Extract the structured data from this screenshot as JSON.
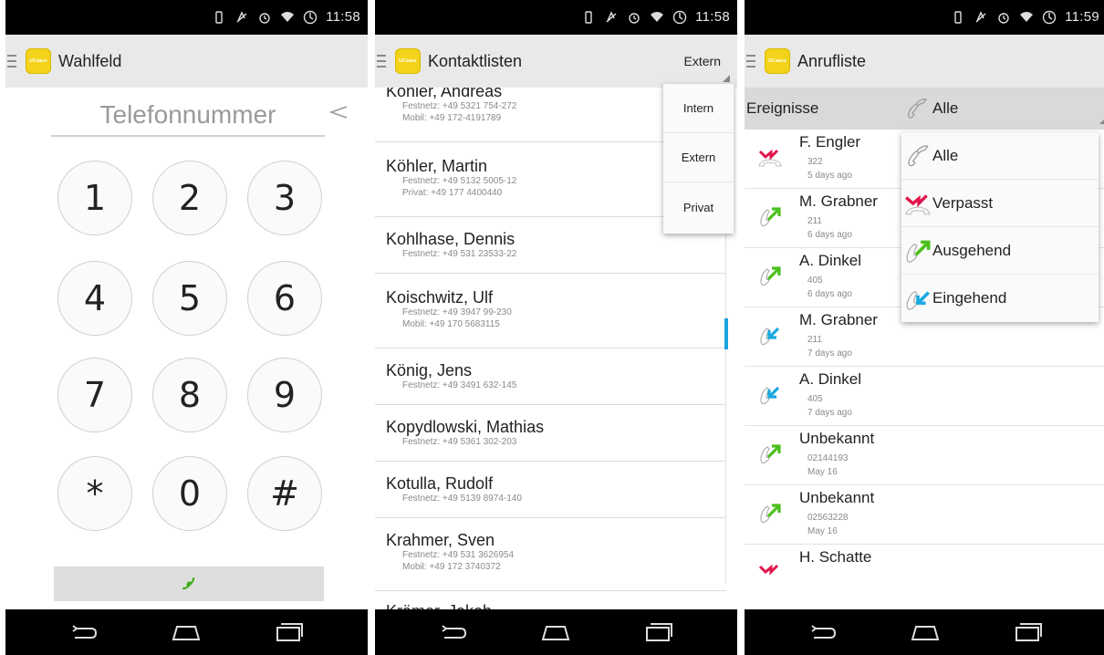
{
  "status": {
    "time": "11:58",
    "time3": "11:59"
  },
  "screen1": {
    "title": "Wahlfeld",
    "phone_placeholder": "Telefonnummer",
    "keys": [
      "1",
      "2",
      "3",
      "4",
      "5",
      "6",
      "7",
      "8",
      "9",
      "*",
      "0",
      "#"
    ]
  },
  "screen2": {
    "title": "Kontaktlisten",
    "filter_button": "Extern",
    "menu": [
      "Intern",
      "Extern",
      "Privat"
    ],
    "contacts": [
      {
        "name": "Köhler, Andreas",
        "lines": [
          "Festnetz: +49 5321 754-272",
          "Mobil: +49 172-4191789"
        ]
      },
      {
        "name": "Köhler, Martin",
        "lines": [
          "Festnetz: +49 5132 5005-12",
          "Privat: +49 177 4400440"
        ]
      },
      {
        "name": "Kohlhase, Dennis",
        "lines": [
          "Festnetz: +49 531 23533-22"
        ]
      },
      {
        "name": "Koischwitz, Ulf",
        "lines": [
          "Festnetz: +49 3947 99-230",
          "Mobil: +49 170 5683115"
        ]
      },
      {
        "name": "König, Jens",
        "lines": [
          "Festnetz: +49 3491 632-145"
        ]
      },
      {
        "name": "Kopydlowski, Mathias",
        "lines": [
          "Festnetz: +49 5361 302-203"
        ]
      },
      {
        "name": "Kotulla, Rudolf",
        "lines": [
          "Festnetz: +49 5139 8974-140"
        ]
      },
      {
        "name": "Krahmer, Sven",
        "lines": [
          "Festnetz: +49 531 3626954",
          "Mobil: +49 172 3740372"
        ]
      },
      {
        "name": "Krämer, Jakob",
        "lines": []
      }
    ]
  },
  "screen3": {
    "title": "Anrufliste",
    "filter_label": "Ereignisse",
    "filter_value": "Alle",
    "menu": [
      "Alle",
      "Verpasst",
      "Ausgehend",
      "Eingehend"
    ],
    "calls": [
      {
        "name": "F. Engler",
        "number": "322",
        "when": "5 days ago",
        "type": "missed"
      },
      {
        "name": "M. Grabner",
        "number": "211",
        "when": "6 days ago",
        "type": "outgoing"
      },
      {
        "name": "A. Dinkel",
        "number": "405",
        "when": "6 days ago",
        "type": "outgoing"
      },
      {
        "name": "M. Grabner",
        "number": "211",
        "when": "7 days ago",
        "type": "incoming"
      },
      {
        "name": "A. Dinkel",
        "number": "405",
        "when": "7 days ago",
        "type": "incoming"
      },
      {
        "name": "Unbekannt",
        "number": "02144193",
        "when": "May 16",
        "type": "outgoing"
      },
      {
        "name": "Unbekannt",
        "number": "02563228",
        "when": "May 16",
        "type": "outgoing"
      },
      {
        "name": "H. Schatte",
        "number": "",
        "when": "",
        "type": "missed"
      }
    ]
  },
  "colors": {
    "app_yellow": "#f3d31a",
    "missed": "#e3154d",
    "outgoing": "#4cbf1c",
    "incoming": "#18a9e0",
    "accent_blue": "#1aa3de",
    "call_green": "#3fae16"
  }
}
